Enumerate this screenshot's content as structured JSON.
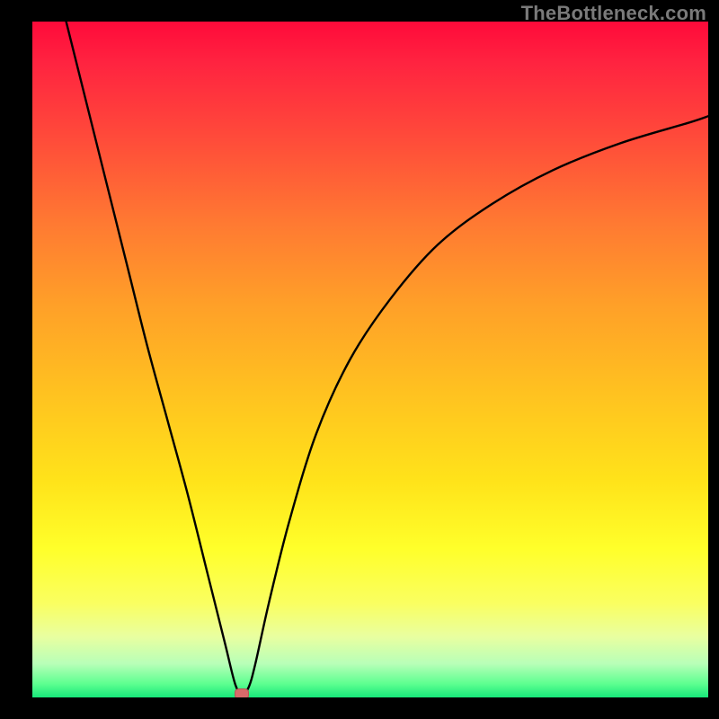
{
  "watermark": "TheBottleneck.com",
  "chart_data": {
    "type": "line",
    "title": "",
    "xlabel": "",
    "ylabel": "",
    "xlim": [
      0,
      100
    ],
    "ylim": [
      0,
      100
    ],
    "grid": false,
    "legend": false,
    "background_gradient": {
      "top": "#ff0a3a",
      "bottom": "#17e87a",
      "stops": [
        "red",
        "orange",
        "yellow",
        "green"
      ]
    },
    "series": [
      {
        "name": "bottleneck-curve",
        "color": "#000000",
        "x": [
          5,
          8,
          11,
          14,
          17,
          20,
          23,
          26,
          28.5,
          30,
          31,
          32,
          33,
          35,
          38,
          42,
          47,
          53,
          60,
          68,
          77,
          87,
          97,
          100
        ],
        "y": [
          100,
          88,
          76,
          64,
          52,
          41,
          30,
          18,
          8,
          2,
          0.5,
          1.5,
          5,
          14,
          26,
          39,
          50,
          59,
          67,
          73,
          78,
          82,
          85,
          86
        ]
      }
    ],
    "marker": {
      "name": "optimum-point",
      "x": 31,
      "y": 0.5,
      "color": "#d76a6a"
    }
  }
}
